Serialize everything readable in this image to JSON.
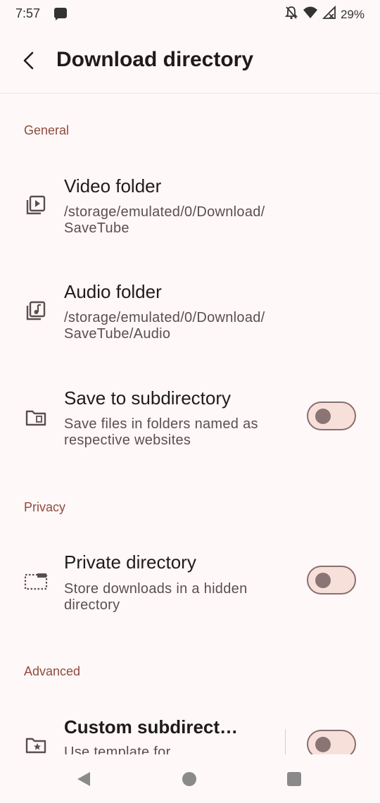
{
  "status_bar": {
    "time": "7:57",
    "battery": "29%"
  },
  "header": {
    "title": "Download directory"
  },
  "sections": {
    "general": "General",
    "privacy": "Privacy",
    "advanced": "Advanced"
  },
  "items": {
    "video_folder": {
      "title": "Video folder",
      "summary_line1": "/storage/emulated/0/Download/",
      "summary_line2": "SaveTube",
      "icon": "video-library-icon"
    },
    "audio_folder": {
      "title": "Audio folder",
      "summary_line1": "/storage/emulated/0/Download/",
      "summary_line2": "SaveTube/Audio",
      "icon": "audio-library-icon"
    },
    "save_subdirectory": {
      "title": "Save to subdirectory",
      "summary_line1": "Save files in folders named as",
      "summary_line2": "respective websites",
      "icon": "folder-icon",
      "enabled": false
    },
    "private_directory": {
      "title": "Private directory",
      "summary_line1": "Store downloads in a hidden",
      "summary_line2": "directory",
      "icon": "hidden-folder-icon",
      "enabled": false
    },
    "custom_subdirectory": {
      "title": "Custom subdirect…",
      "summary_line1": "Use template for",
      "icon": "folder-star-icon",
      "enabled": false
    }
  },
  "colors": {
    "accent": "#8f4a3e",
    "background": "#fff8f8",
    "toggle_track": "#f8e0da"
  }
}
